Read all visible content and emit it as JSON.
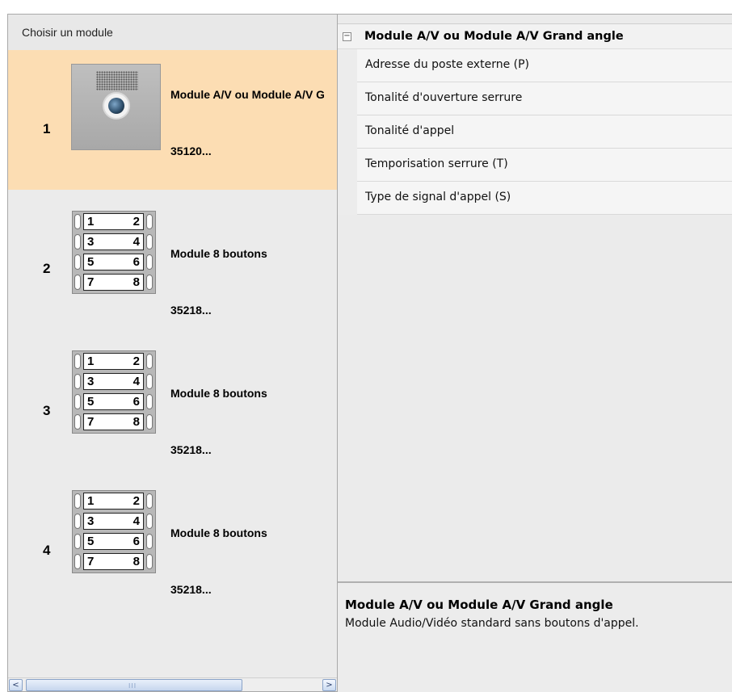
{
  "left_panel": {
    "header": "Choisir un module",
    "modules": [
      {
        "number": "1",
        "name": "Module A/V ou Module A/V Grand angle",
        "code": "35120...",
        "image": "camera-module-image"
      },
      {
        "number": "2",
        "name": "Module 8 boutons",
        "code": "35218...",
        "image": "button-module-image"
      },
      {
        "number": "3",
        "name": "Module 8 boutons",
        "code": "35218...",
        "image": "button-module-image"
      },
      {
        "number": "4",
        "name": "Module 8 boutons",
        "code": "35218...",
        "image": "button-module-image"
      }
    ],
    "button_labels": [
      [
        "1",
        "2"
      ],
      [
        "3",
        "4"
      ],
      [
        "5",
        "6"
      ],
      [
        "7",
        "8"
      ]
    ],
    "scrollbar": {
      "left_icon": "scroll-left-arrow-icon",
      "right_icon": "scroll-right-arrow-icon",
      "left_glyph": "<",
      "right_glyph": ">",
      "grip": "III"
    }
  },
  "properties": {
    "category": "Module A/V ou Module A/V Grand angle",
    "collapse_glyph": "−",
    "rows": [
      "Adresse du poste externe (P)",
      "Tonalité d'ouverture serrure",
      "Tonalité d'appel",
      "Temporisation serrure (T)",
      "Type de signal d'appel (S)"
    ]
  },
  "description": {
    "title": "Module A/V ou Module A/V Grand angle",
    "text": "Module Audio/Vidéo standard sans boutons d'appel."
  },
  "colors": {
    "selected_item": "#fcddb3",
    "panel_bg": "#ebebeb"
  }
}
